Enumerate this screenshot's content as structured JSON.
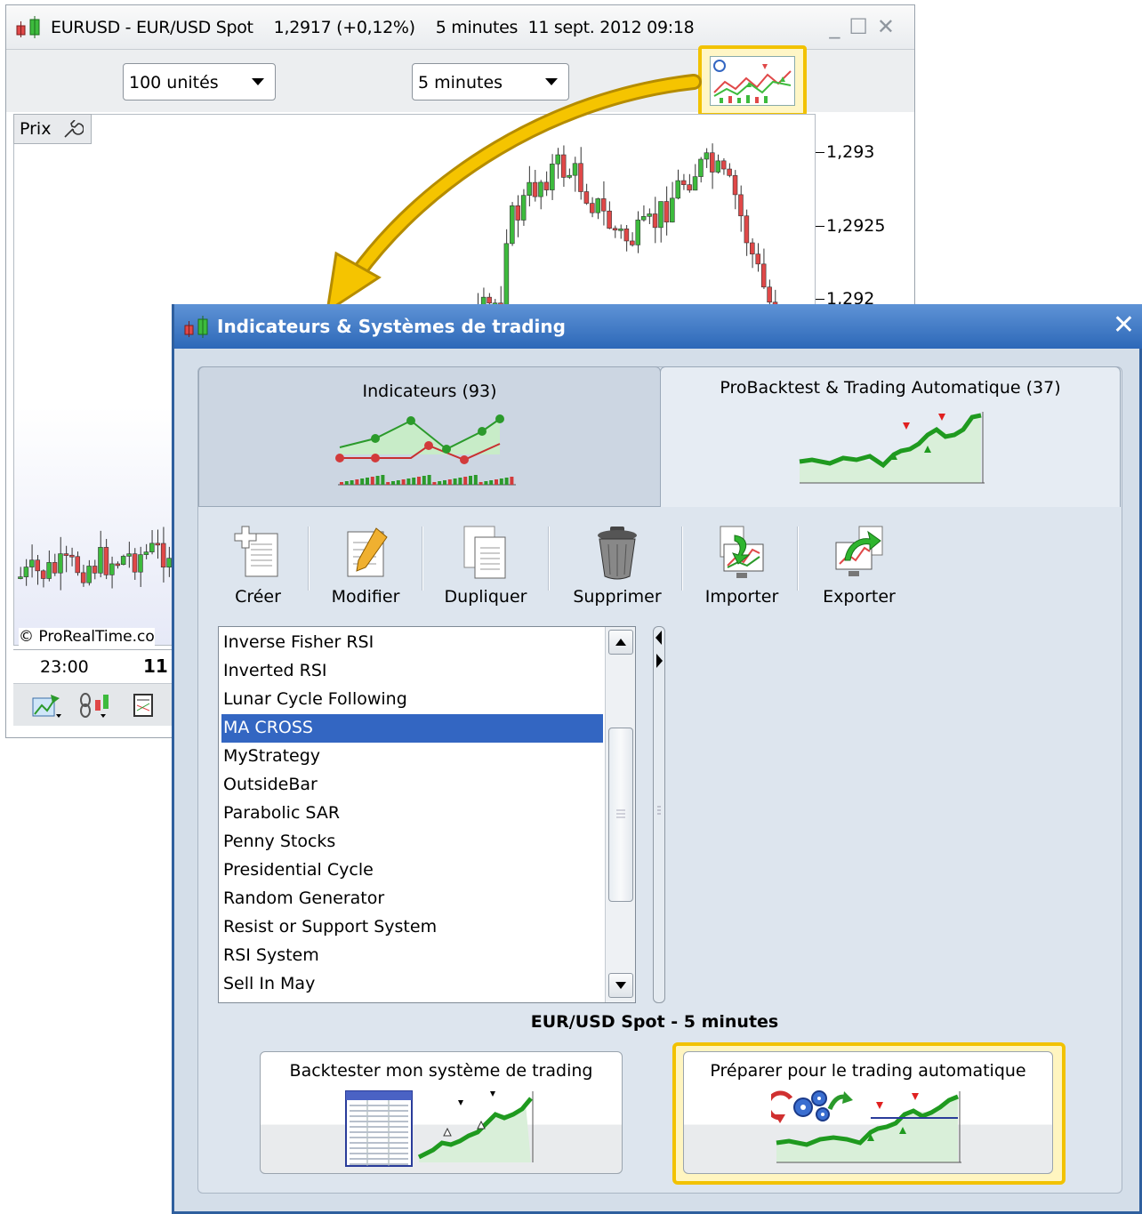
{
  "chart_window": {
    "title": "EURUSD - EUR/USD Spot",
    "price": "1,2917 (+0,12%)",
    "timeframe": "5 minutes",
    "datetime": "11 sept. 2012 09:18",
    "units_dropdown": "100 unités",
    "timeframe_dropdown": "5 minutes",
    "price_label": "Prix",
    "y_labels": [
      "1,293",
      "1,2925",
      "1,292"
    ],
    "copyright": "© ProRealTime.co",
    "x_labels": [
      "23:00",
      "11"
    ]
  },
  "dialog": {
    "title": "Indicateurs & Systèmes de trading",
    "tabs": [
      {
        "label": "Indicateurs (93)"
      },
      {
        "label": "ProBacktest & Trading Automatique (37)"
      }
    ],
    "toolbar": [
      {
        "label": "Créer",
        "icon": "create-icon"
      },
      {
        "label": "Modifier",
        "icon": "edit-icon"
      },
      {
        "label": "Dupliquer",
        "icon": "duplicate-icon"
      },
      {
        "label": "Supprimer",
        "icon": "trash-icon"
      },
      {
        "label": "Importer",
        "icon": "import-icon"
      },
      {
        "label": "Exporter",
        "icon": "export-icon"
      }
    ],
    "list": [
      "Inverse Fisher RSI",
      "Inverted RSI",
      "Lunar Cycle Following",
      "MA CROSS",
      "MyStrategy",
      "OutsideBar",
      "Parabolic SAR",
      "Penny Stocks",
      "Presidential Cycle",
      "Random Generator",
      "Resist or Support System",
      "RSI System",
      "Sell In May"
    ],
    "selected_item": "MA CROSS",
    "instrument_label": "EUR/USD Spot - 5 minutes",
    "backtest_button": "Backtester mon système de trading",
    "auto_button": "Préparer pour le trading automatique"
  },
  "colors": {
    "highlight": "#f2c200",
    "selection": "#3366c2",
    "dialog_title": "#2d68b8",
    "candle_up": "#3dbb3d",
    "candle_down": "#e04848"
  }
}
